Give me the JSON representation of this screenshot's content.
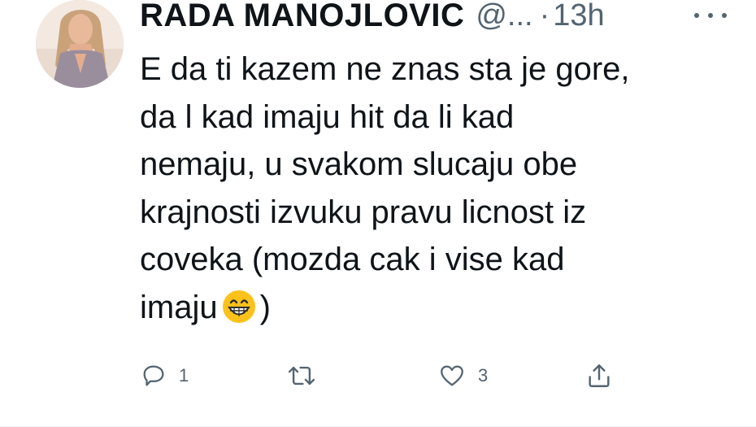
{
  "tweet": {
    "author_name": "RADA MANOJLOVIC",
    "handle": "@...",
    "separator": "·",
    "time": "13h",
    "body_lines": [
      "E da ti kazem ne znas sta je gore,",
      "da l kad imaju hit da li kad",
      "nemaju, u svakom slucaju obe",
      "krajnosti izvuku pravu licnost iz",
      "coveka (mozda cak i vise kad",
      "imaju",
      ")"
    ],
    "emoji": "grinning-face-with-smiling-eyes",
    "actions": {
      "reply_count": "1",
      "retweet_count": "",
      "like_count": "3"
    }
  },
  "icons": {
    "more": "more-horizontal-icon",
    "reply": "reply-bubble-icon",
    "retweet": "retweet-icon",
    "like": "heart-icon",
    "share": "share-icon"
  },
  "colors": {
    "text": "#0f1419",
    "secondary": "#536471",
    "divider": "#eff3f4"
  }
}
